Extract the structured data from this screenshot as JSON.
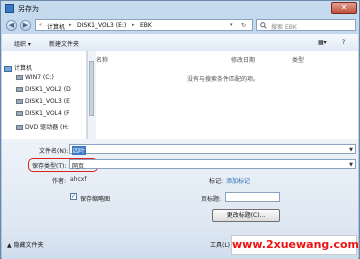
{
  "window": {
    "title": "另存为",
    "close_label": "✕"
  },
  "address": {
    "crumbs": [
      "计算机",
      "DISK1_VOL3 (E:)",
      "EBK"
    ],
    "search_placeholder": "搜索 EBK"
  },
  "toolbar": {
    "organize_label": "组织 ▾",
    "new_folder_label": "新建文件夹"
  },
  "nav_pane": {
    "items": [
      {
        "label": "计算机"
      },
      {
        "label": "WIN7 (C:)"
      },
      {
        "label": "DISK1_VOL2 (D"
      },
      {
        "label": "DISK1_VOL3 (E"
      },
      {
        "label": "DISK1_VOL4 (F"
      },
      {
        "label": "DVD 驱动器 (H:"
      }
    ]
  },
  "file_list": {
    "columns": [
      "名称",
      "修改日期",
      "类型"
    ],
    "empty_message": "没有与搜索条件匹配的项。"
  },
  "form": {
    "filename_label": "文件名(N):",
    "filename_value": "四叶",
    "savetype_label": "保存类型(T):",
    "savetype_value": "网页",
    "author_label": "作者:",
    "author_value": "ahcxf",
    "tags_label": "标记:",
    "tags_value": "添加标记",
    "save_thumbnail_label": "保存缩略图",
    "save_thumbnail_checked": true,
    "page_title_label": "页标题:",
    "change_title_label": "更改标题(C)..."
  },
  "footer": {
    "hide_folders_label": "隐藏文件夹",
    "tools_label": "工具(L)",
    "watermark": "www.2xuewang.com"
  },
  "colors": {
    "accent": "#3a78c3",
    "highlight": "#dd2222",
    "watermark": "#ee1111"
  }
}
